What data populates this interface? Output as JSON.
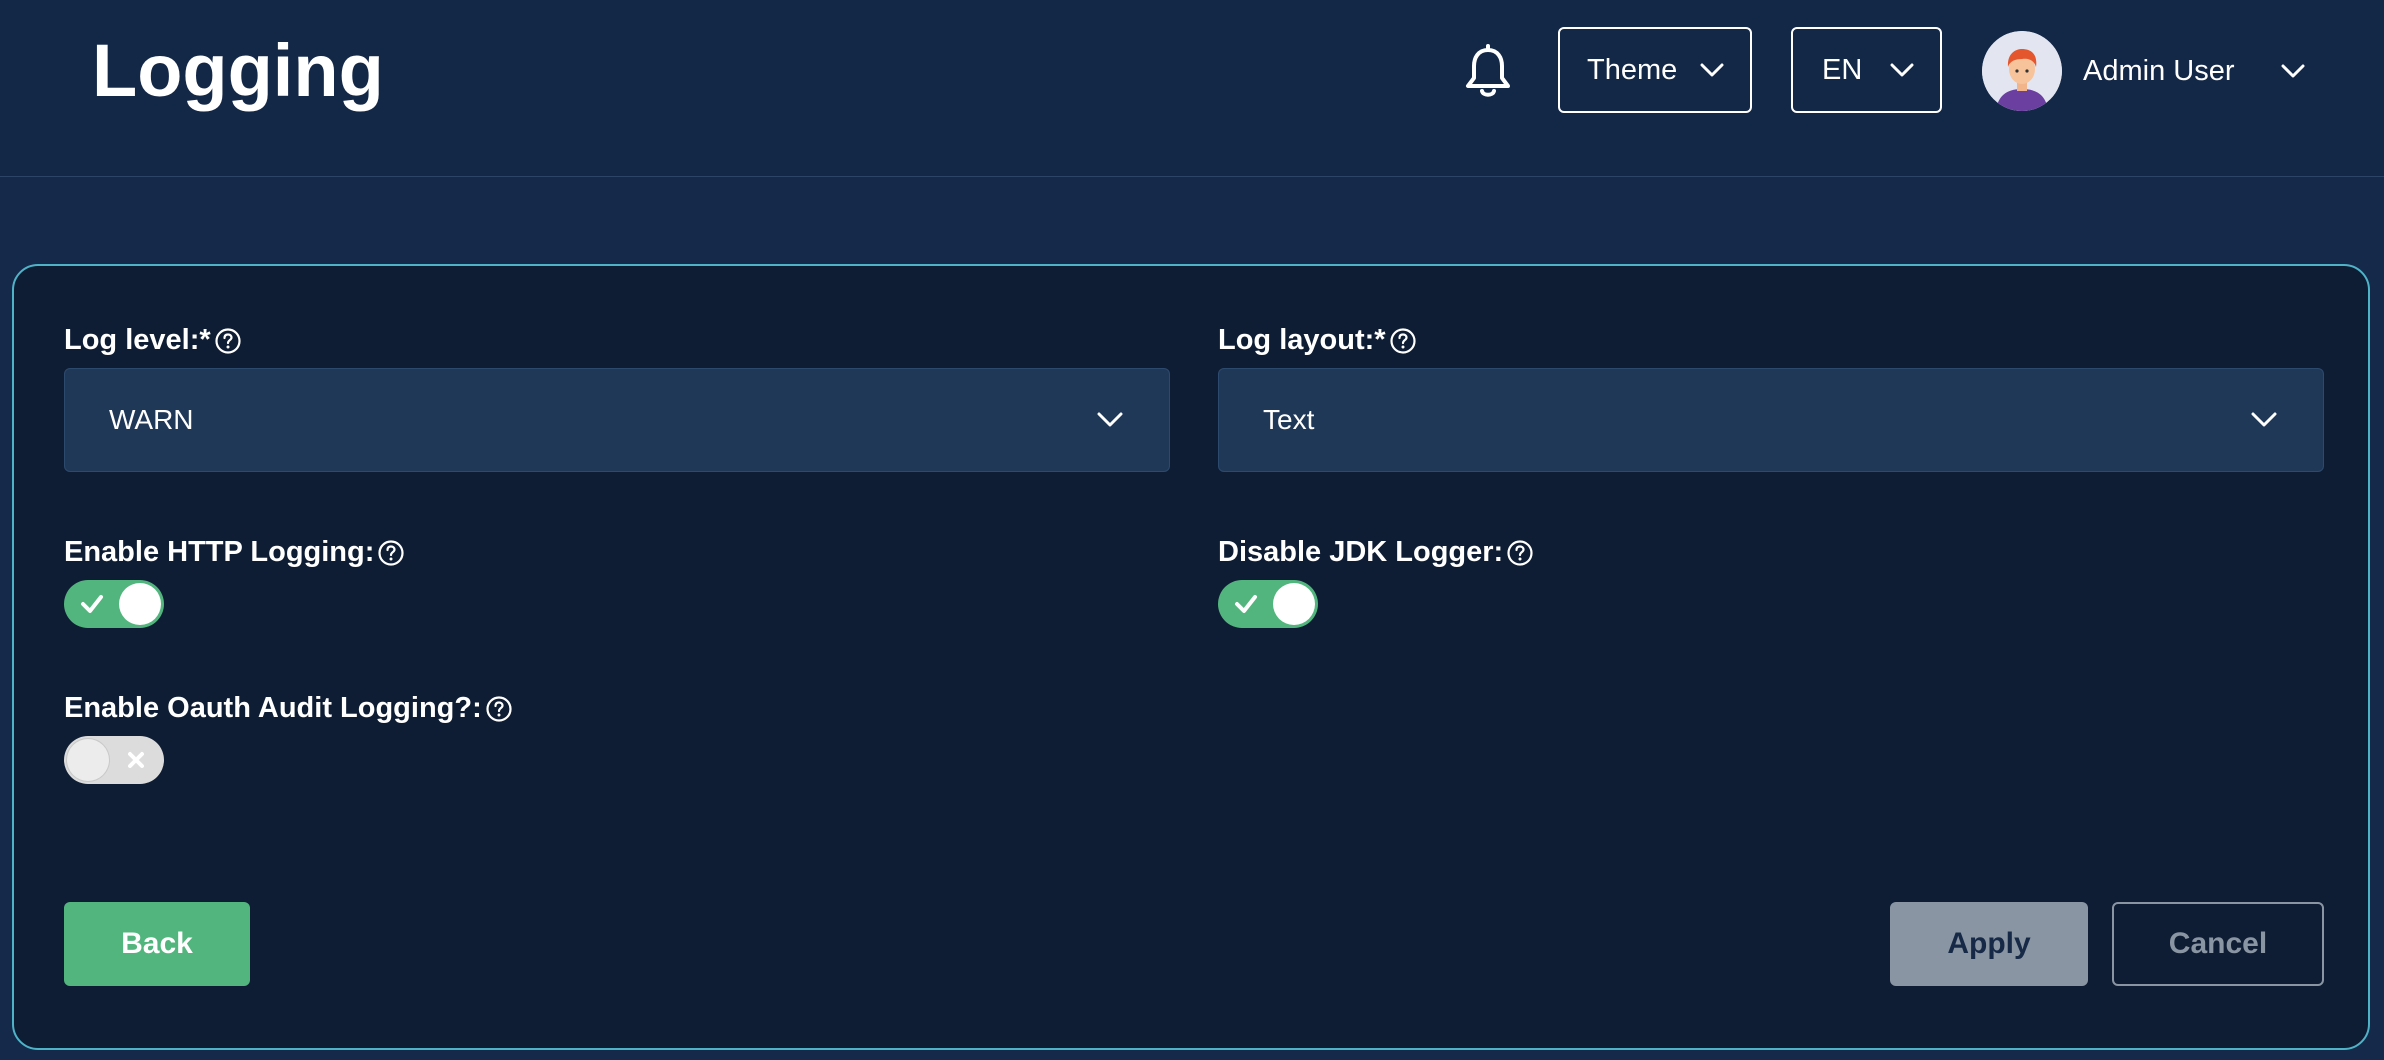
{
  "header": {
    "title": "Logging",
    "theme_label": "Theme",
    "language_label": "EN",
    "user_name": "Admin User",
    "icons": {
      "bell": "bell-icon",
      "chevron": "chevron-down-icon",
      "avatar": "avatar"
    }
  },
  "form": {
    "log_level": {
      "label": "Log level:*",
      "value": "WARN"
    },
    "log_layout": {
      "label": "Log layout:*",
      "value": "Text"
    },
    "http_logging": {
      "label": "Enable HTTP Logging:",
      "enabled": true
    },
    "jdk_logger": {
      "label": "Disable JDK Logger:",
      "enabled": true
    },
    "oauth_audit": {
      "label": "Enable Oauth Audit Logging?:",
      "enabled": false
    }
  },
  "actions": {
    "back_label": "Back",
    "apply_label": "Apply",
    "cancel_label": "Cancel"
  },
  "colors": {
    "background": "#15294a",
    "card": "#0e1d33",
    "card_border": "#4fb3c8",
    "select": "#203858",
    "accent_green": "#52b57d",
    "disabled_gray": "#8a95a3"
  }
}
